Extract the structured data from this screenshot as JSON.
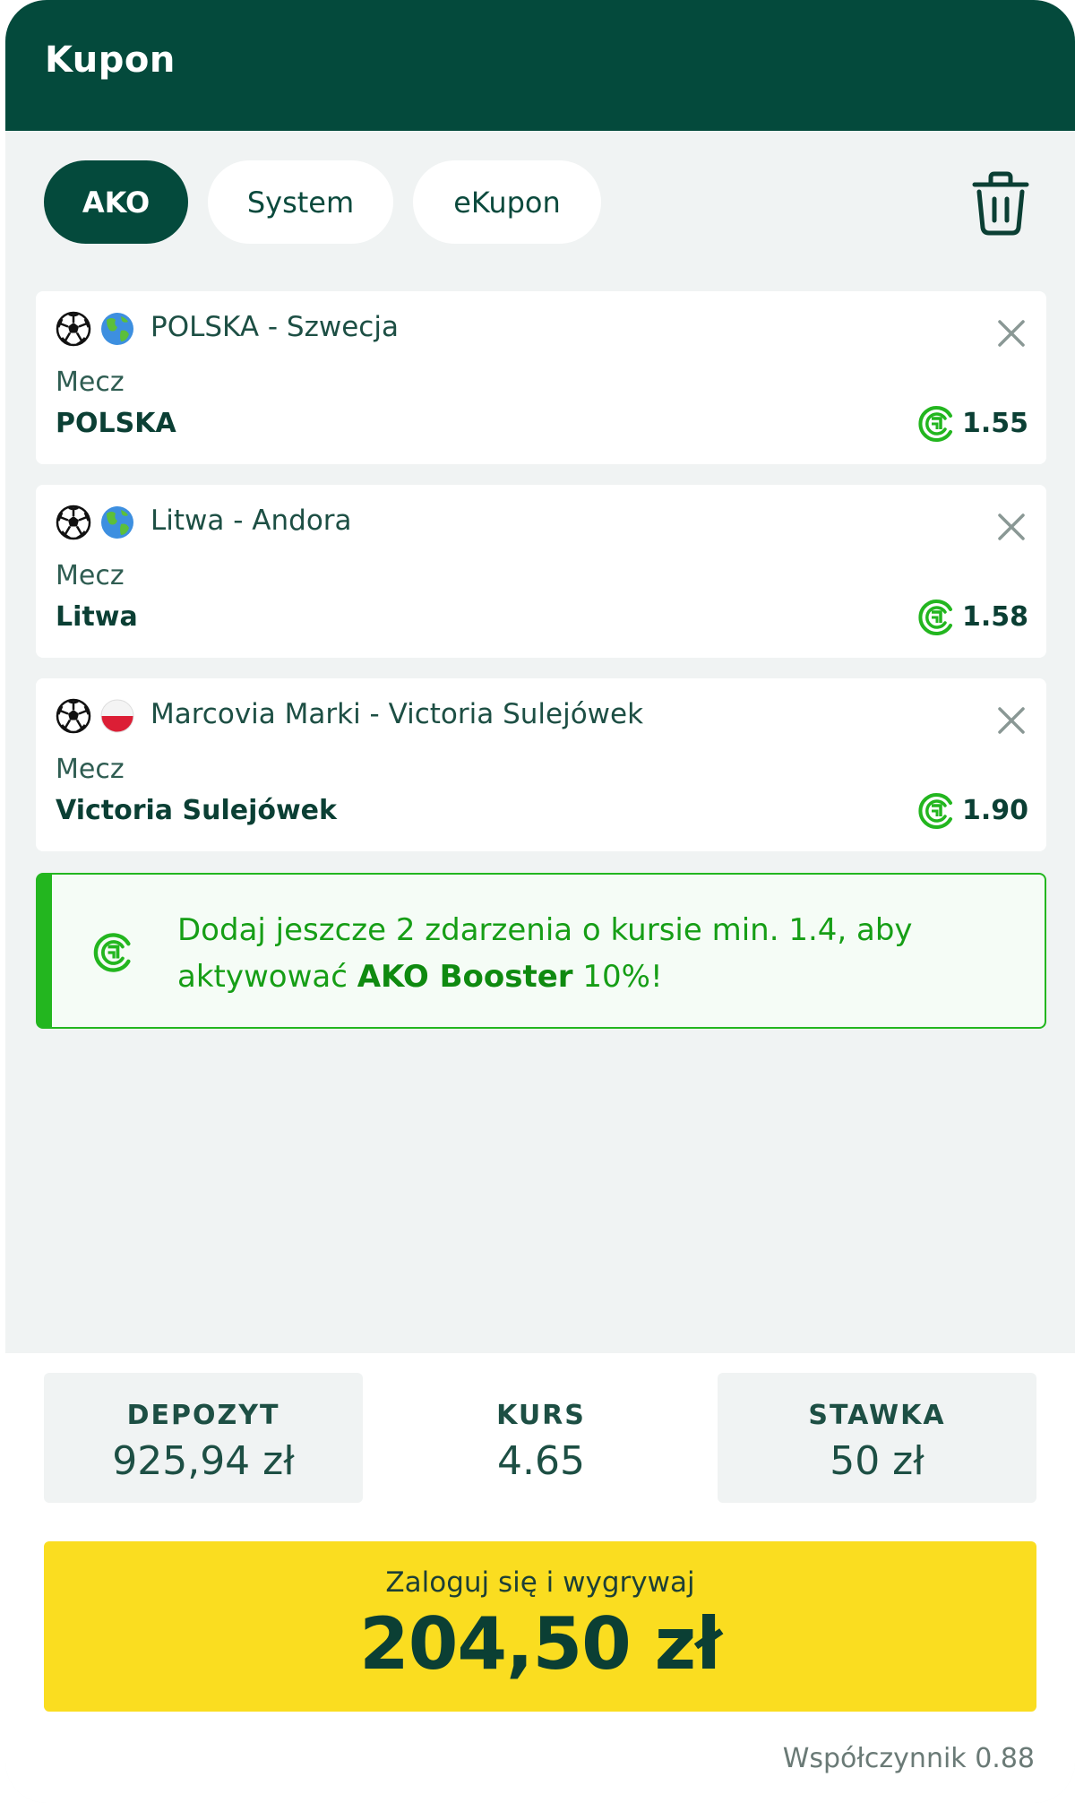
{
  "header": {
    "title": "Kupon"
  },
  "tabs": [
    {
      "label": "AKO",
      "active": true
    },
    {
      "label": "System",
      "active": false
    },
    {
      "label": "eKupon",
      "active": false
    }
  ],
  "selections": [
    {
      "sport_icon": "soccer-ball-icon",
      "region_icon": "globe-icon",
      "match": "POLSKA - Szwecja",
      "market": "Mecz",
      "pick": "POLSKA",
      "odds": "1.55"
    },
    {
      "sport_icon": "soccer-ball-icon",
      "region_icon": "globe-icon",
      "match": "Litwa - Andora",
      "market": "Mecz",
      "pick": "Litwa",
      "odds": "1.58"
    },
    {
      "sport_icon": "soccer-ball-icon",
      "region_icon": "poland-flag-icon",
      "match": "Marcovia Marki - Victoria Sulejówek",
      "market": "Mecz",
      "pick": "Victoria Sulejówek",
      "odds": "1.90"
    }
  ],
  "booster": {
    "text_before": "Dodaj jeszcze 2 zdarzenia o kursie min. 1.4, aby aktywować ",
    "text_bold": "AKO Booster",
    "text_after": " 10%!"
  },
  "summary": {
    "deposit_label": "DEPOZYT",
    "deposit_value": "925,94 zł",
    "odds_label": "KURS",
    "odds_value": "4.65",
    "stake_label": "STAWKA",
    "stake_value": "50 zł"
  },
  "cta": {
    "label": "Zaloguj się i wygrywaj",
    "amount": "204,50 zł"
  },
  "coefficient": "Współczynnik 0.88",
  "colors": {
    "header_bg": "#044a3c",
    "accent_green": "#23b61f",
    "cta_yellow": "#fadd20",
    "page_bg": "#f0f3f3"
  }
}
